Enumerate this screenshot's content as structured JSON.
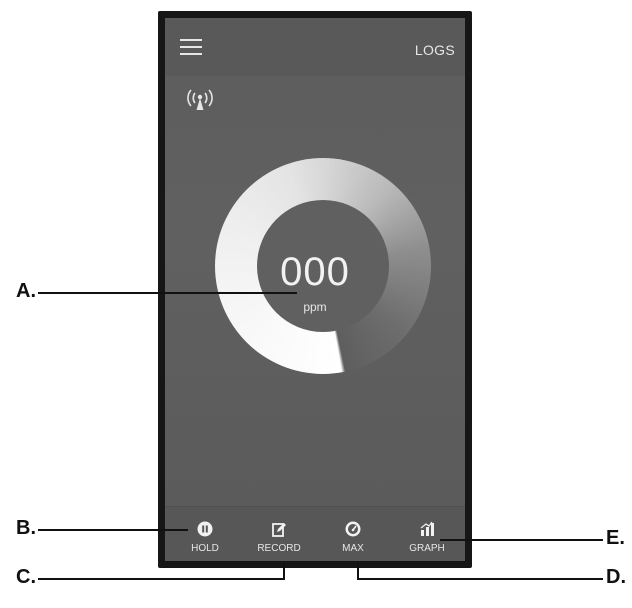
{
  "header": {
    "menu_icon": "hamburger-menu-icon",
    "logs_label": "LOGS"
  },
  "status": {
    "signal_icon": "wireless-signal-icon"
  },
  "reading": {
    "value": "000",
    "unit": "ppm"
  },
  "bottom_nav": [
    {
      "label": "HOLD",
      "icon": "pause-icon"
    },
    {
      "label": "RECORD",
      "icon": "edit-icon"
    },
    {
      "label": "MAX",
      "icon": "gauge-icon"
    },
    {
      "label": "GRAPH",
      "icon": "bar-chart-icon"
    }
  ],
  "callouts": {
    "a": "A.",
    "b": "B.",
    "c": "C.",
    "d": "D.",
    "e": "E."
  },
  "colors": {
    "screen_bg": "#5d5d5d",
    "text": "#e6e6e6",
    "bezel": "#161616"
  }
}
